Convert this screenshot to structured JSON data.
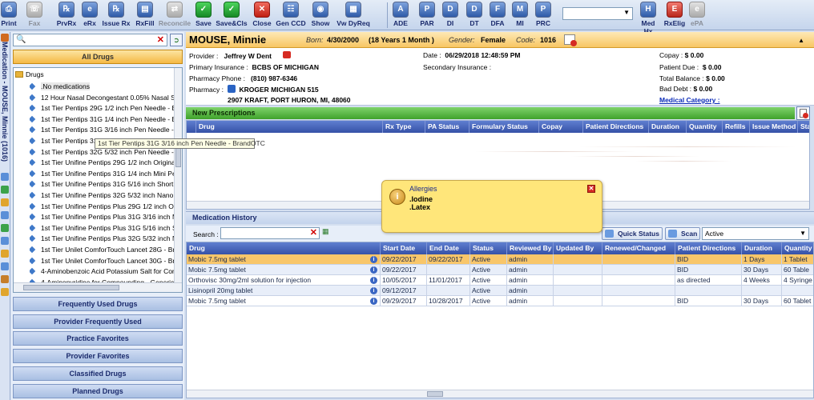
{
  "toolbar": {
    "buttons": [
      {
        "label": "Print",
        "icon": "printer-icon",
        "enabled": true
      },
      {
        "label": "Fax",
        "icon": "fax-icon",
        "enabled": false
      },
      {
        "label": "PrvRx",
        "icon": "previous-rx-icon",
        "enabled": true
      },
      {
        "label": "eRx",
        "icon": "erx-icon",
        "enabled": true
      },
      {
        "label": "Issue Rx",
        "icon": "issue-rx-icon",
        "enabled": true
      },
      {
        "label": "RxFill",
        "icon": "rxfill-icon",
        "enabled": true
      },
      {
        "label": "Reconcile",
        "icon": "reconcile-icon",
        "enabled": false
      },
      {
        "label": "Save",
        "icon": "save-icon",
        "enabled": true
      },
      {
        "label": "Save&Cls",
        "icon": "save-close-icon",
        "enabled": true
      },
      {
        "label": "Close",
        "icon": "close-icon",
        "enabled": true
      },
      {
        "label": "Gen CCD",
        "icon": "gen-ccd-icon",
        "enabled": true
      },
      {
        "label": "Show",
        "icon": "show-icon",
        "enabled": true
      },
      {
        "label": "Vw DyReq",
        "icon": "view-dyreq-icon",
        "enabled": true
      },
      {
        "label": "ADE",
        "icon": "ade-icon",
        "enabled": true
      },
      {
        "label": "PAR",
        "icon": "par-icon",
        "enabled": true
      },
      {
        "label": "DI",
        "icon": "di-icon",
        "enabled": true
      },
      {
        "label": "DT",
        "icon": "dt-icon",
        "enabled": true
      },
      {
        "label": "DFA",
        "icon": "dfa-icon",
        "enabled": true
      },
      {
        "label": "MI",
        "icon": "mi-icon",
        "enabled": true
      },
      {
        "label": "PRC",
        "icon": "prc-icon",
        "enabled": true
      },
      {
        "label": "Med Hx",
        "icon": "med-hx-icon",
        "enabled": true
      },
      {
        "label": "RxElig",
        "icon": "rx-elig-icon",
        "enabled": true
      },
      {
        "label": "ePA",
        "icon": "epa-icon",
        "enabled": false
      }
    ],
    "dropdown_value": ""
  },
  "sidebar": {
    "vertical_title": "Medication - MOUSE, Minnie (1016)",
    "all_drugs_label": "All Drugs",
    "search_value": "",
    "tree_root": "Drugs",
    "drugs": [
      ".No medications",
      "12 Hour Nasal Decongestant 0.05% Nasal Sp",
      "1st Tier Pentips 29G 1/2 inch Pen Needle - Br",
      "1st Tier Pentips 31G 1/4 inch Pen Needle - Br",
      "1st Tier Pentips 31G 3/16 inch Pen Needle - B",
      "1st Tier Pentips 31G 5/16 inch Pen Needle",
      "1st Tier Pentips 32G 5/32 inch Pen Needle - B",
      "1st Tier Unifine Pentips 29G 1/2 inch Original",
      "1st Tier Unifine Pentips 31G 1/4 inch Mini Pe",
      "1st Tier Unifine Pentips 31G 5/16 inch Short",
      "1st Tier Unifine Pentips 32G 5/32 inch Nano I",
      "1st Tier Unifine Pentips Plus 29G 1/2 inch Ori",
      "1st Tier Unifine Pentips Plus 31G 3/16 inch M",
      "1st Tier Unifine Pentips Plus 31G 5/16 inch Sl",
      "1st Tier Unifine Pentips Plus 32G 5/32 inch N",
      "1st Tier Unilet ComforTouch Lancet 28G - Bra",
      "1st Tier Unilet ComforTouch Lancet 30G - Bra",
      "4-Aminobenzoic Acid Potassium Salt for Comp",
      "4-Aminopyridine for Compounding - Generic"
    ],
    "tooltip": "1st Tier Pentips 31G 3/16 inch Pen Needle - BrandOTC",
    "categories": [
      "Frequently Used Drugs",
      "Provider Frequently Used",
      "Practice Favorites",
      "Provider Favorites",
      "Classified Drugs",
      "Planned Drugs"
    ]
  },
  "patient": {
    "name": "MOUSE, Minnie",
    "born_label": "Born:",
    "born_value": "4/30/2000",
    "age": "(18 Years 1 Month )",
    "gender_label": "Gender:",
    "gender_value": "Female",
    "code_label": "Code:",
    "code_value": "1016",
    "provider_label": "Provider :",
    "provider_value": "Jeffrey W Dent",
    "primary_ins_label": "Primary Insurance :",
    "primary_ins_value": "BCBS OF MICHIGAN",
    "phone_label": "Pharmacy Phone :",
    "phone_value": "(810) 987-6346",
    "pharmacy_label": "Pharmacy :",
    "pharmacy_value": "KROGER MICHIGAN 515",
    "pharmacy_address": "2907 KRAFT, PORT HURON, MI, 48060",
    "date_label": "Date :",
    "date_value": "06/29/2018 12:48:59 PM",
    "secondary_ins_label": "Secondary Insurance :",
    "copay_label": "Copay :",
    "copay_value": "$ 0.00",
    "due_label": "Patient Due :",
    "due_value": "$ 0.00",
    "balance_label": "Total Balance :",
    "balance_value": "$ 0.00",
    "bad_debt_label": "Bad Debt :",
    "bad_debt_value": "$ 0.00",
    "medical_category_link": "Medical Category :"
  },
  "new_prescriptions": {
    "title": "New Prescriptions",
    "columns": [
      "Drug",
      "Rx Type",
      "PA Status",
      "Formulary Status",
      "Copay",
      "Patient Directions",
      "Duration",
      "Quantity",
      "Refills",
      "Issue Method",
      "Sta"
    ]
  },
  "allergies": {
    "title": "Allergies",
    "items": [
      ".Iodine",
      ".Latex"
    ]
  },
  "medication_history": {
    "title": "Medication History",
    "search_label": "Search :",
    "search_value": "",
    "quick_status_label": "Quick Status",
    "scan_label": "Scan",
    "filter_value": "Active",
    "columns": [
      "Drug",
      "Start Date",
      "End Date",
      "Status",
      "Reviewed By",
      "Updated By",
      "Renewed/Changed",
      "Patient Directions",
      "Duration",
      "Quantity"
    ],
    "rows": [
      {
        "drug": "Mobic 7.5mg tablet",
        "start": "09/22/2017",
        "end": "09/22/2017",
        "status": "Active",
        "reviewed": "admin",
        "updated": "",
        "renewed": "",
        "directions": "BID",
        "duration": "1 Days",
        "quantity": "1 Tablet"
      },
      {
        "drug": "Mobic 7.5mg tablet",
        "start": "09/22/2017",
        "end": "",
        "status": "Active",
        "reviewed": "admin",
        "updated": "",
        "renewed": "",
        "directions": "BID",
        "duration": "30 Days",
        "quantity": "60 Table"
      },
      {
        "drug": "Orthovisc 30mg/2ml solution for injection",
        "start": "10/05/2017",
        "end": "11/01/2017",
        "status": "Active",
        "reviewed": "admin",
        "updated": "",
        "renewed": "",
        "directions": "as directed",
        "duration": "4 Weeks",
        "quantity": "4 Syringe"
      },
      {
        "drug": "Lisinopril 20mg tablet",
        "start": "09/12/2017",
        "end": "",
        "status": "Active",
        "reviewed": "admin",
        "updated": "",
        "renewed": "",
        "directions": "",
        "duration": "",
        "quantity": ""
      },
      {
        "drug": "Mobic 7.5mg tablet",
        "start": "09/29/2017",
        "end": "10/28/2017",
        "status": "Active",
        "reviewed": "admin",
        "updated": "",
        "renewed": "",
        "directions": "BID",
        "duration": "30 Days",
        "quantity": "60 Tablet"
      }
    ]
  },
  "colors": {
    "header_orange": "#f8c663",
    "grid_header_blue": "#3651a7",
    "new_rx_green": "#3fa12b",
    "allergy_yellow": "#ffe67a",
    "selected_row": "#f8c66a"
  }
}
